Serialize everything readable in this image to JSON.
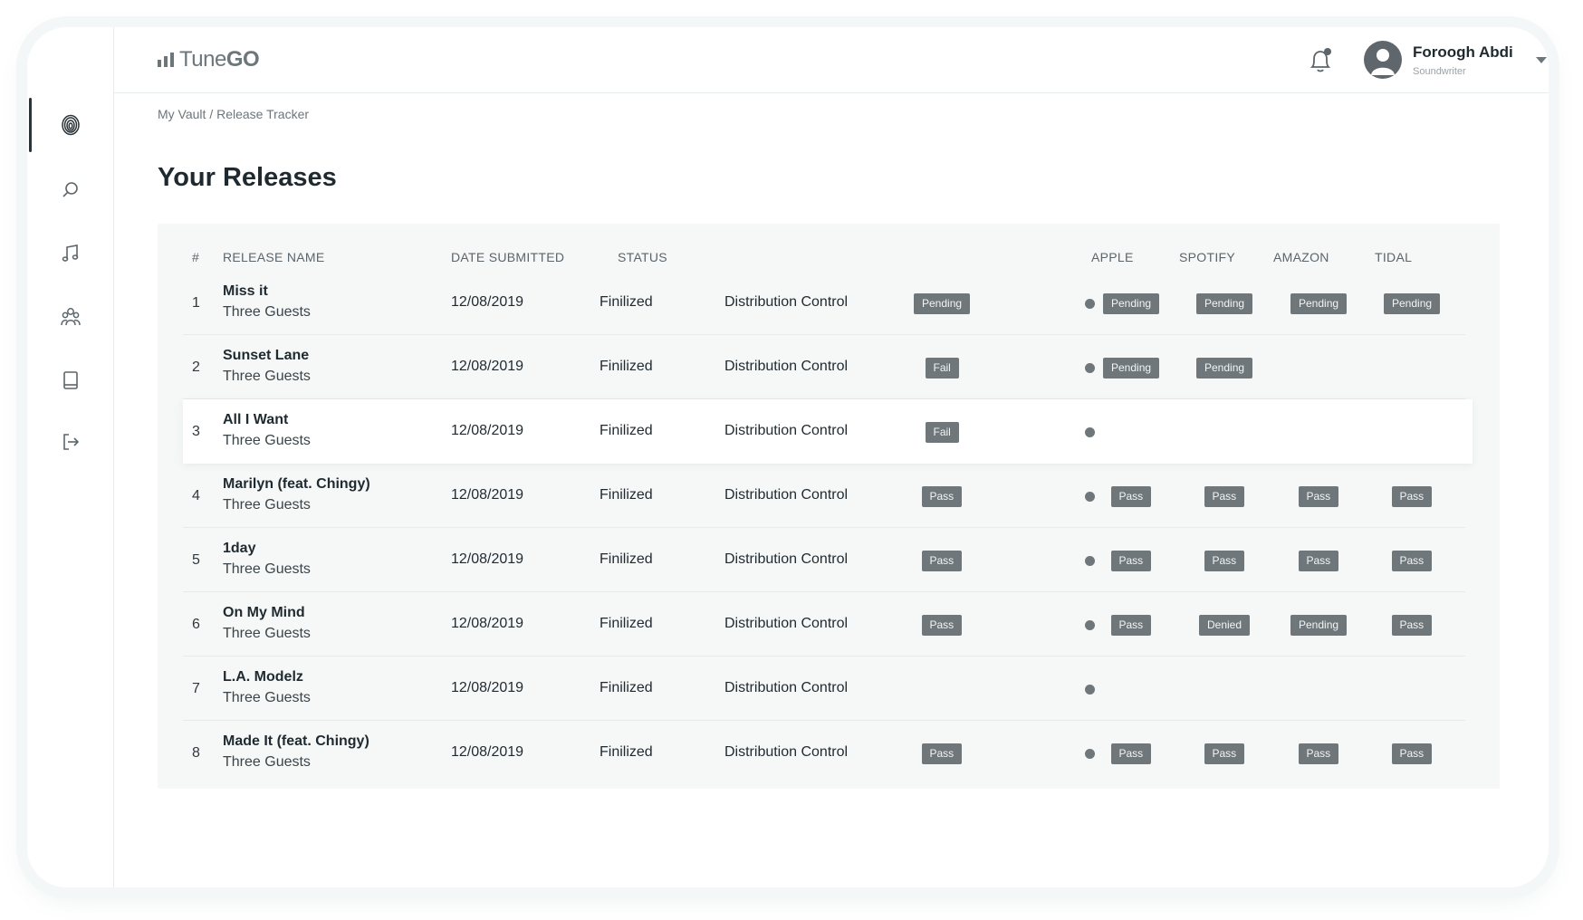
{
  "app": {
    "logo_text": "Tune",
    "logo_bold": "GO"
  },
  "user": {
    "name": "Foroogh Abdi",
    "role": "Soundwriter"
  },
  "breadcrumb": "My Vault / Release Tracker",
  "page_title": "Your Releases",
  "sidebar": {
    "items": [
      {
        "icon": "fingerprint-icon",
        "active": true
      },
      {
        "icon": "search-icon",
        "active": false
      },
      {
        "icon": "music-note-icon",
        "active": false
      },
      {
        "icon": "users-icon",
        "active": false
      },
      {
        "icon": "book-icon",
        "active": false
      },
      {
        "icon": "logout-icon",
        "active": false
      }
    ]
  },
  "table": {
    "headers": {
      "num": "#",
      "release_name": "RELEASE NAME",
      "date_submitted": "DATE SUBMITTED",
      "status": "STATUS",
      "apple": "APPLE",
      "spotify": "SPOTIFY",
      "amazon": "AMAZON",
      "tidal": "TIDAL"
    },
    "rows": [
      {
        "num": "1",
        "name": "Miss it",
        "artist": "Three Guests",
        "date": "12/08/2019",
        "status": "Finilized",
        "control": "Distribution Control",
        "overall": "Pending",
        "apple": "Pending",
        "spotify": "Pending",
        "amazon": "Pending",
        "tidal": "Pending",
        "highlight": false
      },
      {
        "num": "2",
        "name": "Sunset Lane",
        "artist": "Three Guests",
        "date": "12/08/2019",
        "status": "Finilized",
        "control": "Distribution Control",
        "overall": "Fail",
        "apple": "Pending",
        "spotify": "Pending",
        "amazon": "",
        "tidal": "",
        "highlight": false
      },
      {
        "num": "3",
        "name": "All I Want",
        "artist": "Three Guests",
        "date": "12/08/2019",
        "status": "Finilized",
        "control": "Distribution Control",
        "overall": "Fail",
        "apple": "",
        "spotify": "",
        "amazon": "",
        "tidal": "",
        "highlight": true
      },
      {
        "num": "4",
        "name": "Marilyn (feat. Chingy)",
        "artist": "Three Guests",
        "date": "12/08/2019",
        "status": "Finilized",
        "control": "Distribution Control",
        "overall": "Pass",
        "apple": "Pass",
        "spotify": "Pass",
        "amazon": "Pass",
        "tidal": "Pass",
        "highlight": false
      },
      {
        "num": "5",
        "name": "1day",
        "artist": "Three Guests",
        "date": "12/08/2019",
        "status": "Finilized",
        "control": "Distribution Control",
        "overall": "Pass",
        "apple": "Pass",
        "spotify": "Pass",
        "amazon": "Pass",
        "tidal": "Pass",
        "highlight": false
      },
      {
        "num": "6",
        "name": "On My Mind",
        "artist": "Three Guests",
        "date": "12/08/2019",
        "status": "Finilized",
        "control": "Distribution Control",
        "overall": "Pass",
        "apple": "Pass",
        "spotify": "Denied",
        "amazon": "Pending",
        "tidal": "Pass",
        "highlight": false
      },
      {
        "num": "7",
        "name": "L.A. Modelz",
        "artist": "Three Guests",
        "date": "12/08/2019",
        "status": "Finilized",
        "control": "Distribution Control",
        "overall": "",
        "apple": "",
        "spotify": "",
        "amazon": "",
        "tidal": "",
        "highlight": false
      },
      {
        "num": "8",
        "name": "Made It (feat. Chingy)",
        "artist": "Three Guests",
        "date": "12/08/2019",
        "status": "Finilized",
        "control": "Distribution Control",
        "overall": "Pass",
        "apple": "Pass",
        "spotify": "Pass",
        "amazon": "Pass",
        "tidal": "Pass",
        "highlight": false
      }
    ]
  }
}
